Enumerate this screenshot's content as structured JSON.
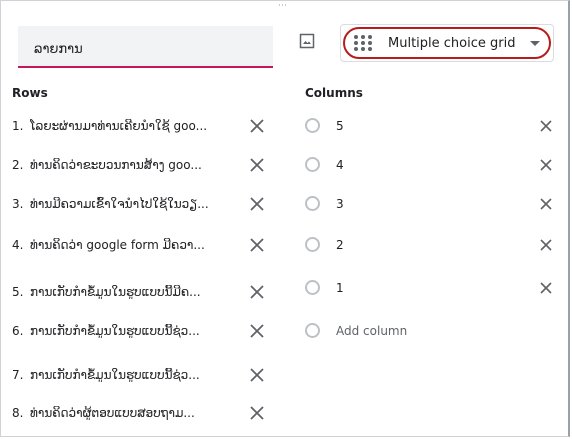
{
  "question": {
    "title_value": "ລາຍການ",
    "type_select": {
      "selected": "Multiple choice grid",
      "icon": "grid-dots-icon"
    },
    "image_button_icon": "image-icon"
  },
  "rows": {
    "header": "Rows",
    "items": [
      {
        "num": "1.",
        "text": "ໂລຍະຜ່ານມາທ່ານເຄີຍນຳໃຊ້ goo..."
      },
      {
        "num": "2.",
        "text": "ທ່ານຄິດວ່າຂະບວນການສ້າງ goo..."
      },
      {
        "num": "3.",
        "text": "ທ່ານມີຄວາມເຂົ້າໃຈນຳໄປໃຊ້ໃນວຽ..."
      },
      {
        "num": "4.",
        "text": "ທ່ານຄິດວ່າ google form ມີຄວາ..."
      },
      {
        "num": "5.",
        "text": "ການເກັບກຳຂໍ້ມູນໃນຮູບແບບນີ້ມີຄ..."
      },
      {
        "num": "6.",
        "text": "ການເກັບກຳຂໍ້ມູນໃນຮູບແບບນີ້ຊ່ວ..."
      },
      {
        "num": "7.",
        "text": "ການເກັບກຳຂໍ້ມູນໃນຮູບແບບນີ້ຊ່ວ..."
      },
      {
        "num": "8.",
        "text": "ທ່ານຄິດວ່າຜູ້ຕອບແບບສອບຖາມ..."
      }
    ]
  },
  "columns": {
    "header": "Columns",
    "items": [
      "5",
      "4",
      "3",
      "2",
      "1"
    ],
    "add_label": "Add column"
  }
}
